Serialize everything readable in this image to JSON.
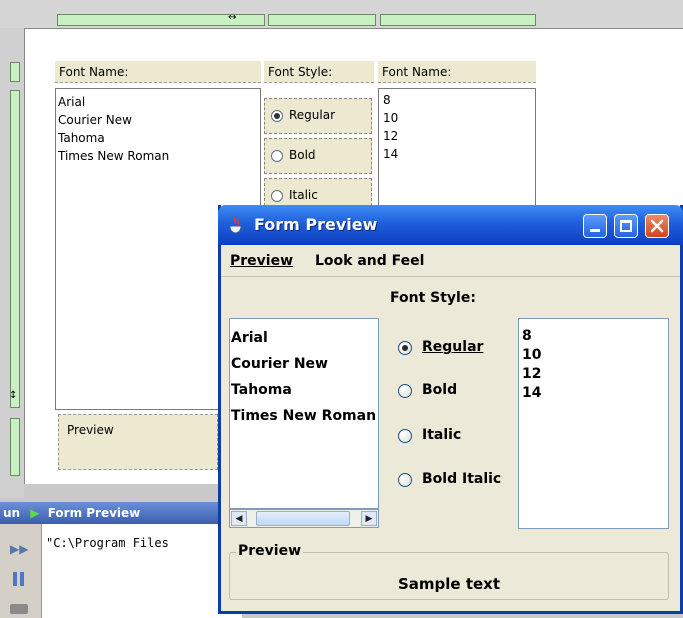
{
  "designer": {
    "header_font_name_left": "Font Name:",
    "header_font_style": "Font Style:",
    "header_font_name_right": "Font Name:",
    "fonts": [
      "Arial",
      "Courier New",
      "Tahoma",
      "Times New Roman"
    ],
    "styles": [
      "Regular",
      "Bold",
      "Italic"
    ],
    "sizes": [
      "8",
      "10",
      "12",
      "14"
    ],
    "preview_label": "Preview"
  },
  "output": {
    "tab_prefix": "un",
    "title": "Form Preview",
    "text": "\"C:\\Program Files"
  },
  "window": {
    "title": "Form Preview",
    "menu": [
      "Preview",
      "Look and Feel"
    ],
    "font_style_label": "Font Style:",
    "fonts": [
      "Arial",
      "Courier New",
      "Tahoma",
      "Times New Roman"
    ],
    "styles": [
      {
        "label": "Regular",
        "selected": true
      },
      {
        "label": "Bold",
        "selected": false
      },
      {
        "label": "Italic",
        "selected": false
      },
      {
        "label": "Bold Italic",
        "selected": false
      }
    ],
    "sizes": [
      "8",
      "10",
      "12",
      "14"
    ],
    "preview_group_label": "Preview",
    "sample_text": "Sample text"
  },
  "colors": {
    "titlebar_blue": "#1f5fdc",
    "close_red": "#d2421c",
    "guide_green": "#c8f0c0"
  }
}
